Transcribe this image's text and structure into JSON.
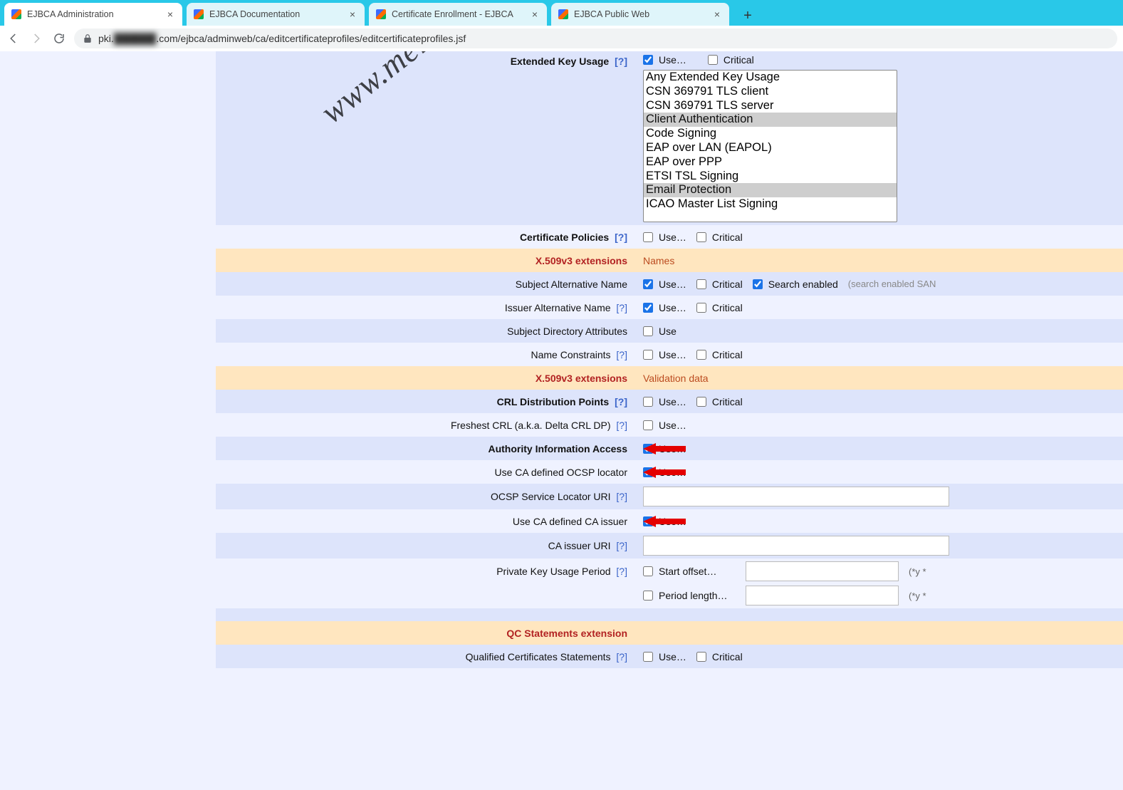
{
  "browser": {
    "tabs": [
      {
        "title": "EJBCA Administration",
        "active": true
      },
      {
        "title": "EJBCA Documentation",
        "active": false
      },
      {
        "title": "Certificate Enrollment - EJBCA",
        "active": false
      },
      {
        "title": "EJBCA Public Web",
        "active": false
      }
    ],
    "url_prefix": "pki.",
    "url_blurred": "██████",
    "url_suffix": ".com/ejbca/adminweb/ca/editcertificateprofiles/editcertificateprofiles.jsf"
  },
  "watermark": "www.meilongkui.com",
  "labels": {
    "use": "Use…",
    "use_plain": "Use",
    "critical": "Critical",
    "search_enabled": "Search enabled",
    "search_hint": "(search enabled SAN",
    "start_offset": "Start offset…",
    "period_length": "Period length…",
    "period_suffix": "(*y *"
  },
  "rows": {
    "eku": {
      "label": "Extended Key Usage",
      "help": "[?]",
      "use": true,
      "critical": false,
      "options": [
        "Any Extended Key Usage",
        "CSN 369791 TLS client",
        "CSN 369791 TLS server",
        "Client Authentication",
        "Code Signing",
        "EAP over LAN (EAPOL)",
        "EAP over PPP",
        "ETSI TSL Signing",
        "Email Protection",
        "ICAO Master List Signing"
      ],
      "selected": [
        "Client Authentication",
        "Email Protection"
      ]
    },
    "cert_policies": {
      "label": "Certificate Policies",
      "help": "[?]",
      "use": false,
      "critical": false
    },
    "section_names": {
      "label": "X.509v3 extensions",
      "value": "Names"
    },
    "san": {
      "label": "Subject Alternative Name",
      "use": true,
      "critical": false,
      "search": true
    },
    "ian": {
      "label": "Issuer Alternative Name",
      "help": "[?]",
      "use": true,
      "critical": false
    },
    "sda": {
      "label": "Subject Directory Attributes",
      "use": false
    },
    "nc": {
      "label": "Name Constraints",
      "help": "[?]",
      "use": false,
      "critical": false
    },
    "section_validation": {
      "label": "X.509v3 extensions",
      "value": "Validation data"
    },
    "crldp": {
      "label": "CRL Distribution Points",
      "help": "[?]",
      "use": false,
      "critical": false
    },
    "freshest": {
      "label": "Freshest CRL (a.k.a. Delta CRL DP)",
      "help": "[?]",
      "use": false
    },
    "aia": {
      "label": "Authority Information Access",
      "use": true
    },
    "ocsp_loc": {
      "label": "Use CA defined OCSP locator",
      "use": true
    },
    "ocsp_uri": {
      "label": "OCSP Service Locator URI",
      "help": "[?]",
      "value": ""
    },
    "ca_issuer": {
      "label": "Use CA defined CA issuer",
      "use": true
    },
    "ca_issuer_uri": {
      "label": "CA issuer URI",
      "help": "[?]",
      "value": ""
    },
    "pkup": {
      "label": "Private Key Usage Period",
      "help": "[?]",
      "start": false,
      "length": false,
      "start_val": "",
      "length_val": ""
    },
    "section_qc": {
      "label": "QC Statements extension"
    },
    "qcs": {
      "label": "Qualified Certificates Statements",
      "help": "[?]",
      "use": false,
      "critical": false
    }
  }
}
